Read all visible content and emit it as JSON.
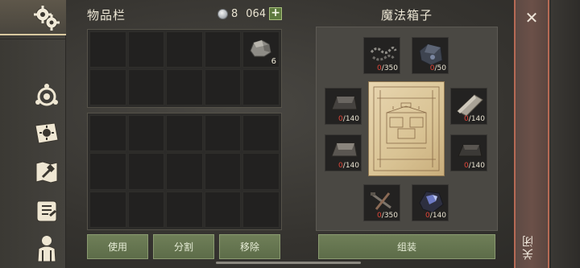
{
  "sidebar": {
    "icons": [
      "settings-gear-icon",
      "compass-icon",
      "journal-sun-icon",
      "map-hammer-icon",
      "recipe-scroll-icon",
      "character-icon"
    ]
  },
  "inventory": {
    "title": "物品栏",
    "coins": "8",
    "coin_cap": "064",
    "plus": "+",
    "stone_qty": "6",
    "buttons": {
      "use": "使用",
      "split": "分割",
      "remove": "移除"
    }
  },
  "magic_box": {
    "title": "魔法箱子",
    "materials": [
      {
        "name": "rope",
        "have": "0",
        "need": "/350"
      },
      {
        "name": "iron-ore",
        "have": "0",
        "need": "/50"
      },
      {
        "name": "metal-ingot",
        "have": "0",
        "need": "/140"
      },
      {
        "name": "stone-slab",
        "have": "0",
        "need": "/140"
      },
      {
        "name": "metal-bar",
        "have": "0",
        "need": "/140"
      },
      {
        "name": "iron-ingot",
        "have": "0",
        "need": "/140"
      },
      {
        "name": "nails",
        "have": "0",
        "need": "/350"
      },
      {
        "name": "crystal-ore",
        "have": "0",
        "need": "/140"
      }
    ],
    "assemble": "组装"
  },
  "close": {
    "x": "✕",
    "label": "关闭"
  }
}
